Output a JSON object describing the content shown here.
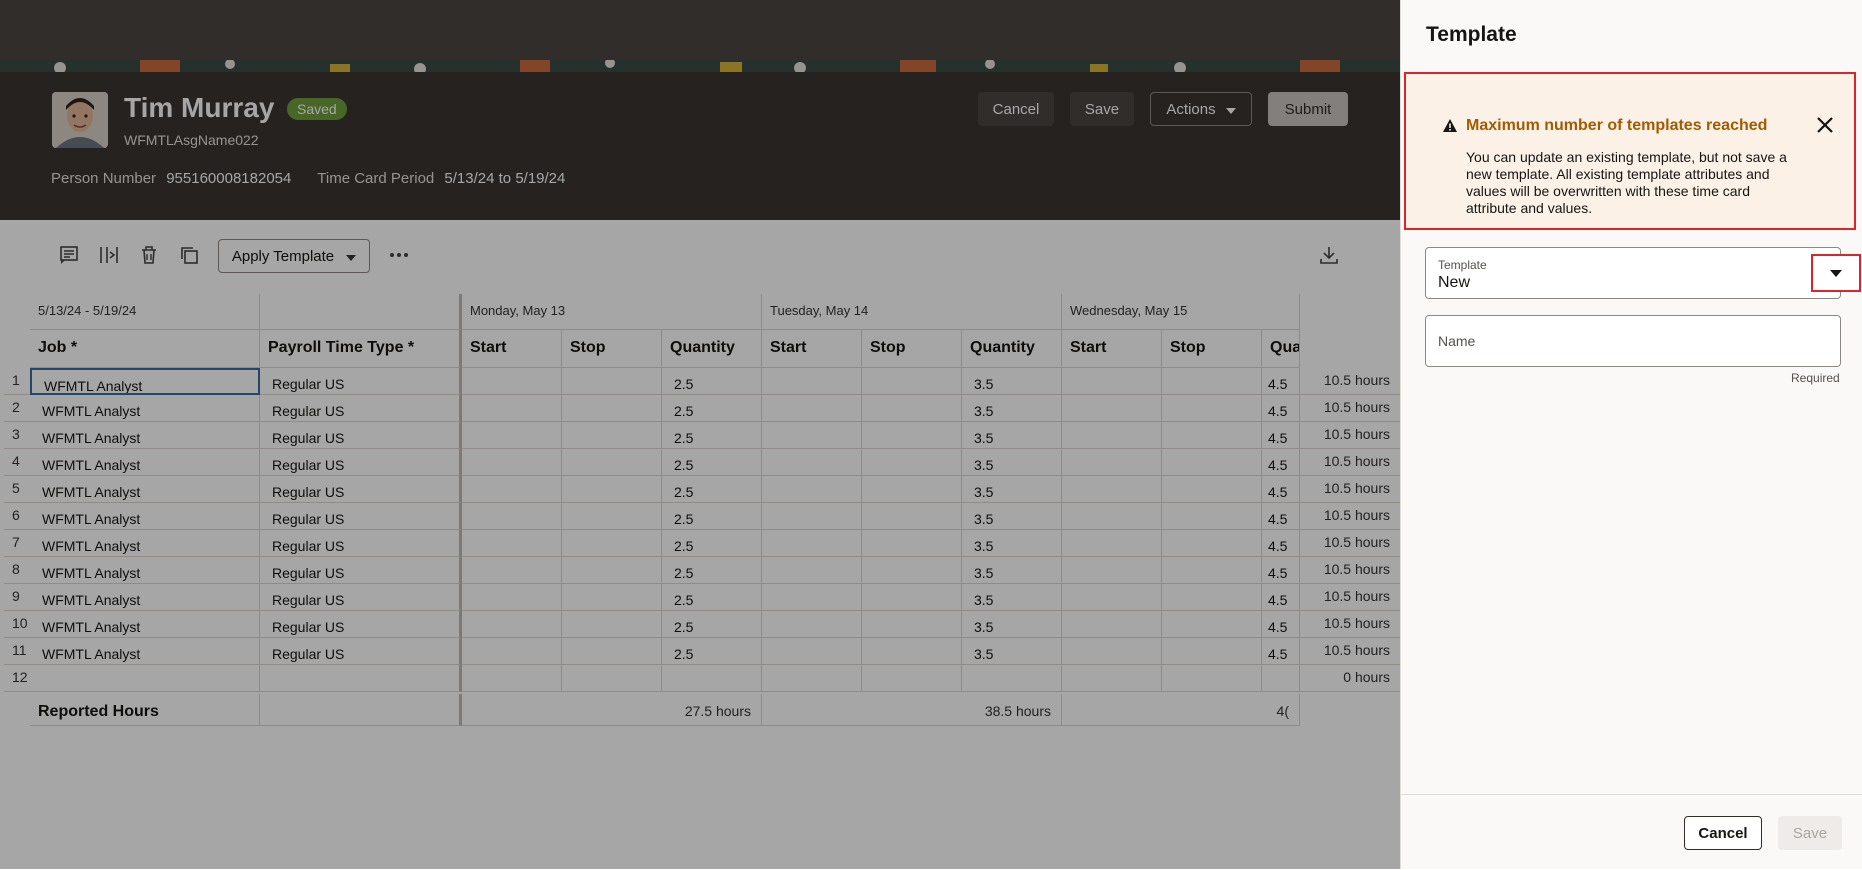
{
  "header": {
    "person_name": "Tim Murray",
    "status": "Saved",
    "assignment": "WFMTLAsgName022",
    "person_number_label": "Person Number",
    "person_number": "955160008182054",
    "period_label": "Time Card Period",
    "period": "5/13/24 to 5/19/24",
    "buttons": {
      "cancel": "Cancel",
      "save": "Save",
      "actions": "Actions",
      "submit": "Submit"
    }
  },
  "toolbar": {
    "apply_template": "Apply Template"
  },
  "grid": {
    "range": "5/13/24 - 5/19/24",
    "days": [
      "Monday, May 13",
      "Tuesday, May 14",
      "Wednesday, May 15"
    ],
    "columns": {
      "job": "Job *",
      "payroll": "Payroll Time Type *",
      "start": "Start",
      "stop": "Stop",
      "quantity": "Quantity",
      "quantity_trunc": "Qua"
    },
    "rows": [
      {
        "n": "1",
        "job": "WFMTL Analyst",
        "type": "Regular US",
        "q1": "2.5",
        "q2": "3.5",
        "q3": "4.5",
        "hours": "10.5 hours"
      },
      {
        "n": "2",
        "job": "WFMTL Analyst",
        "type": "Regular US",
        "q1": "2.5",
        "q2": "3.5",
        "q3": "4.5",
        "hours": "10.5 hours"
      },
      {
        "n": "3",
        "job": "WFMTL Analyst",
        "type": "Regular US",
        "q1": "2.5",
        "q2": "3.5",
        "q3": "4.5",
        "hours": "10.5 hours"
      },
      {
        "n": "4",
        "job": "WFMTL Analyst",
        "type": "Regular US",
        "q1": "2.5",
        "q2": "3.5",
        "q3": "4.5",
        "hours": "10.5 hours"
      },
      {
        "n": "5",
        "job": "WFMTL Analyst",
        "type": "Regular US",
        "q1": "2.5",
        "q2": "3.5",
        "q3": "4.5",
        "hours": "10.5 hours"
      },
      {
        "n": "6",
        "job": "WFMTL Analyst",
        "type": "Regular US",
        "q1": "2.5",
        "q2": "3.5",
        "q3": "4.5",
        "hours": "10.5 hours"
      },
      {
        "n": "7",
        "job": "WFMTL Analyst",
        "type": "Regular US",
        "q1": "2.5",
        "q2": "3.5",
        "q3": "4.5",
        "hours": "10.5 hours"
      },
      {
        "n": "8",
        "job": "WFMTL Analyst",
        "type": "Regular US",
        "q1": "2.5",
        "q2": "3.5",
        "q3": "4.5",
        "hours": "10.5 hours"
      },
      {
        "n": "9",
        "job": "WFMTL Analyst",
        "type": "Regular US",
        "q1": "2.5",
        "q2": "3.5",
        "q3": "4.5",
        "hours": "10.5 hours"
      },
      {
        "n": "10",
        "job": "WFMTL Analyst",
        "type": "Regular US",
        "q1": "2.5",
        "q2": "3.5",
        "q3": "4.5",
        "hours": "10.5 hours"
      },
      {
        "n": "11",
        "job": "WFMTL Analyst",
        "type": "Regular US",
        "q1": "2.5",
        "q2": "3.5",
        "q3": "4.5",
        "hours": "10.5 hours"
      },
      {
        "n": "12",
        "job": "",
        "type": "",
        "q1": "",
        "q2": "",
        "q3": "",
        "hours": "0 hours"
      }
    ],
    "totals": {
      "label": "Reported Hours",
      "mon": "27.5 hours",
      "tue": "38.5 hours",
      "wed": "4("
    }
  },
  "panel": {
    "title": "Template",
    "warning_title": "Maximum number of templates reached",
    "warning_text": "You can update an existing template, but not save a new template. All existing template attributes and values will be overwritten with these time card attribute and values.",
    "template_label": "Template",
    "template_value": "New",
    "name_placeholder": "Name",
    "required": "Required",
    "cancel": "Cancel",
    "save": "Save"
  },
  "colors": {
    "accent_error": "#d7262e",
    "warning_title": "#a35b00",
    "status_green": "#6f9e3b",
    "header_bg": "#3a3532"
  },
  "icons": [
    "comment-icon",
    "split-columns-icon",
    "delete-icon",
    "copy-icon",
    "more-icon",
    "download-icon",
    "warning-icon",
    "close-icon",
    "chevron-down-icon"
  ]
}
